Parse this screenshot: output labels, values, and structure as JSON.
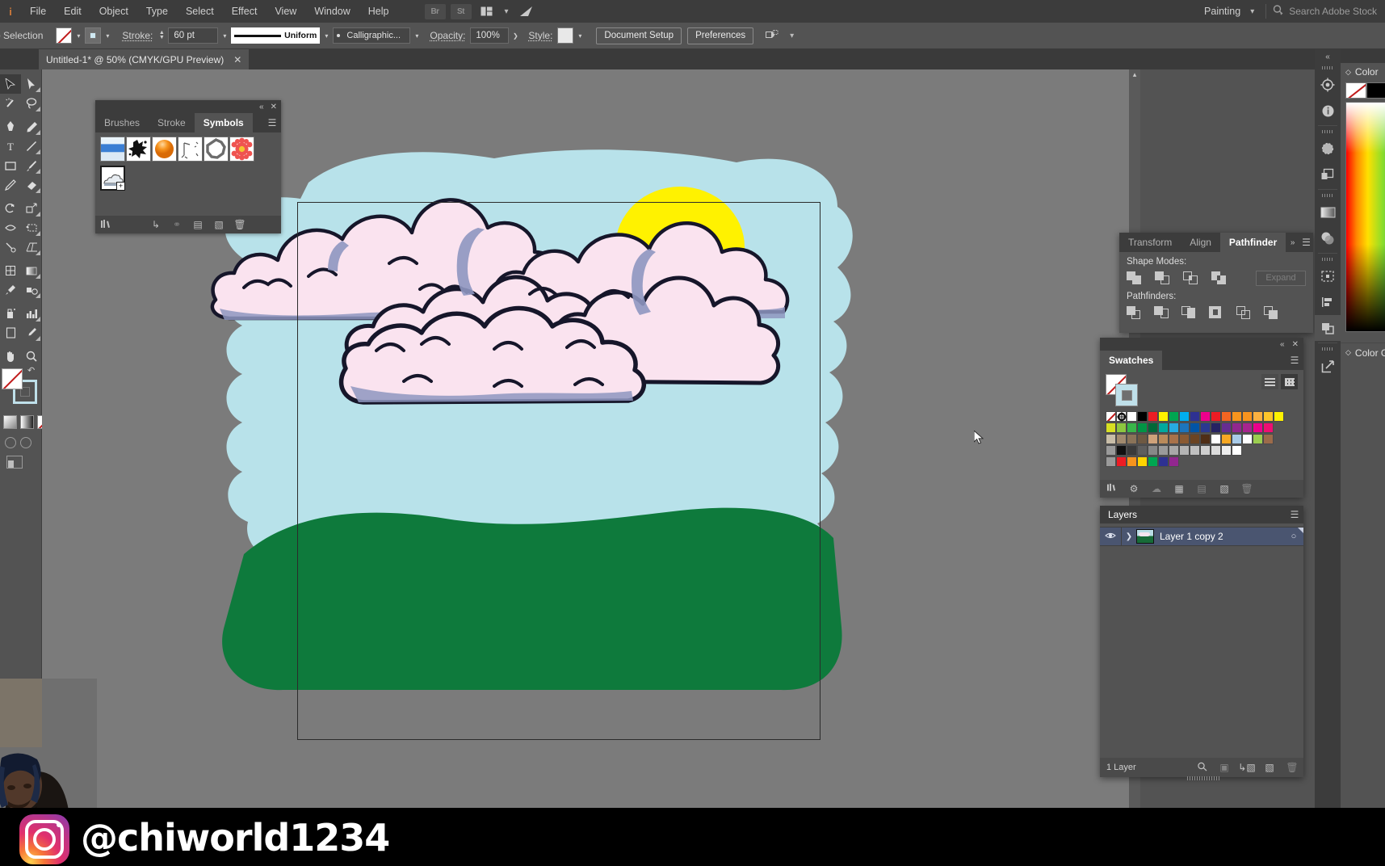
{
  "app": {
    "menus": [
      "File",
      "Edit",
      "Object",
      "Type",
      "Select",
      "Effect",
      "View",
      "Window",
      "Help"
    ],
    "bridge_label": "Br",
    "stock_label": "St",
    "arrange_icon": "arrange-documents-icon",
    "logo_icon": "illustrator-logo-icon",
    "workspace": "Painting",
    "search_placeholder": "Search Adobe Stock",
    "search_icon": "search-icon"
  },
  "controlbar": {
    "selection_status": "o Selection",
    "fill_label": "fill-swatch",
    "stroke_swatch_label": "stroke-swatch",
    "stroke_label": "Stroke:",
    "stroke_weight": "60 pt",
    "profile_name": "Uniform",
    "brush_name": "Calligraphic...",
    "opacity_label": "Opacity:",
    "opacity_value": "100%",
    "style_label": "Style:",
    "document_setup": "Document Setup",
    "preferences": "Preferences",
    "select_similar_icon": "select-similar-objects-icon"
  },
  "document": {
    "tab_title": "Untitled-1* @ 50% (CMYK/GPU Preview)",
    "close_icon": "close-icon",
    "zoom": "50%",
    "color_mode": "CMYK/GPU Preview"
  },
  "toolbar": {
    "tools": [
      "selection-tool",
      "direct-selection-tool",
      "magic-wand-tool",
      "lasso-tool",
      "pen-tool",
      "curvature-tool",
      "type-tool",
      "line-segment-tool",
      "rectangle-tool",
      "paintbrush-tool",
      "shaper-tool",
      "eraser-tool",
      "rotate-tool",
      "scale-tool",
      "width-tool",
      "free-transform-tool",
      "shape-builder-tool",
      "perspective-grid-tool",
      "mesh-tool",
      "gradient-tool",
      "eyedropper-tool",
      "blend-tool",
      "symbol-sprayer-tool",
      "column-graph-tool",
      "artboard-tool",
      "slice-tool",
      "hand-tool",
      "zoom-tool"
    ],
    "fill_state": "none",
    "stroke_state": "selected",
    "fill_stroke_swap_icon": "swap-fill-stroke-icon",
    "color_modes": [
      "color-swatch",
      "gradient-swatch",
      "none-swatch"
    ],
    "draw_modes": [
      "draw-normal",
      "draw-behind",
      "draw-inside"
    ],
    "screen_mode_icon": "change-screen-mode-icon"
  },
  "symbols_panel": {
    "tabs": [
      "Brushes",
      "Stroke",
      "Symbols"
    ],
    "active_tab": "Symbols",
    "collapse_icon": "collapse-panel-icon",
    "close_icon": "close-icon",
    "menu_icon": "panel-menu-icon",
    "symbols": [
      {
        "name": "sky-gradient-symbol",
        "type": "gradient-blue"
      },
      {
        "name": "ink-splat-symbol",
        "type": "splat-black"
      },
      {
        "name": "orange-sphere-symbol",
        "type": "sphere-orange"
      },
      {
        "name": "grass-blades-symbol",
        "type": "sketch-lines"
      },
      {
        "name": "gear-ring-symbol",
        "type": "ring-gray"
      },
      {
        "name": "flower-symbol",
        "type": "flower-red"
      },
      {
        "name": "cloud-symbol",
        "type": "cloud-sketch",
        "selected": true
      }
    ],
    "footer_icons": [
      "symbol-libraries-icon",
      "place-symbol-instance-icon",
      "break-link-icon",
      "symbol-options-icon",
      "new-symbol-icon",
      "delete-symbol-icon"
    ]
  },
  "pathfinder_panel": {
    "tabs": [
      "Transform",
      "Align",
      "Pathfinder"
    ],
    "active_tab": "Pathfinder",
    "expand_tabs_icon": "expand-tabs-icon",
    "menu_icon": "panel-menu-icon",
    "shape_modes_label": "Shape Modes:",
    "shape_modes": [
      "unite-icon",
      "minus-front-icon",
      "intersect-icon",
      "exclude-icon"
    ],
    "expand_button": "Expand",
    "pathfinders_label": "Pathfinders:",
    "pathfinders": [
      "divide-icon",
      "trim-icon",
      "merge-icon",
      "crop-icon",
      "outline-icon",
      "minus-back-icon"
    ]
  },
  "swatches_panel": {
    "title": "Swatches",
    "collapse_icon": "collapse-panel-icon",
    "close_icon": "close-icon",
    "menu_icon": "panel-menu-icon",
    "view_list_icon": "list-view-icon",
    "view_grid_icon": "grid-view-icon",
    "none_swatch": "none-swatch",
    "active_swatch": "active-fill-swatch",
    "rows": [
      [
        "none",
        "registration",
        "#ffffff",
        "#000000",
        "#ec1c24",
        "#fff200",
        "#00a651",
        "#00aeef",
        "#2e3192",
        "#ec008c",
        "#ed1c24",
        "#f26522",
        "#f7941d",
        "#f7931e",
        "#fbb040",
        "#fdc52a",
        "#fff200"
      ],
      [
        "#d7df23",
        "#8dc63f",
        "#39b54a",
        "#009444",
        "#006838",
        "#00a99d",
        "#27aae1",
        "#1c75bc",
        "#0054a6",
        "#2b3990",
        "#262262",
        "#662d91",
        "#92278f",
        "#a7248e",
        "#ec008c",
        "#ed0e72"
      ],
      [
        "#c8bda8",
        "#a18a6e",
        "#8a7358",
        "#6e5942",
        "#cfa27a",
        "#b98a5a",
        "#a8724a",
        "#8a5a32",
        "#6b4423",
        "#4f2e16",
        "#ffffff",
        "#f7a823",
        "#a9cbe8",
        "#ffffff",
        "#9bcd50",
        "#9c6b4a"
      ],
      [
        "folder",
        "#111111",
        "#3a3a3a",
        "#5e5e5e",
        "#888888",
        "#9a9a9a",
        "#a8a8a8",
        "#b4b4b4",
        "#c0c0c0",
        "#cfcfcf",
        "#dcdcdc",
        "#eeeeee",
        "#ffffff"
      ],
      [
        "folder",
        "#ed1c24",
        "#f7941d",
        "#ffd400",
        "#00a651",
        "#2e3192",
        "#92278f"
      ]
    ],
    "footer_icons": [
      "swatch-libraries-icon",
      "show-swatch-kinds-icon",
      "swatch-options-icon",
      "new-color-group-icon",
      "new-swatch-icon",
      "delete-swatch-icon"
    ]
  },
  "layers_panel": {
    "title": "Layers",
    "menu_icon": "panel-menu-icon",
    "layers": [
      {
        "name": "Layer 1 copy 2",
        "visible": true,
        "locked": false,
        "expanded": false,
        "selected": true,
        "eye_icon": "eye-icon",
        "expand_icon": "chevron-right-icon",
        "target_icon": "target-circle-icon"
      }
    ],
    "count_label": "1 Layer",
    "footer_icons": [
      "locate-object-icon",
      "make-clipping-mask-icon",
      "create-new-sublayer-icon",
      "create-new-layer-icon",
      "delete-selection-icon"
    ]
  },
  "color_panel": {
    "title": "Color",
    "guide_title": "Color Gui",
    "none_chip": "none-swatch",
    "fill_chip": "#000000",
    "stroke_chip": "#ffffff",
    "spectrum_label": "color-spectrum-ramp"
  },
  "right_rail": {
    "collapse_icon": "collapse-panels-icon",
    "icons": [
      "color-wheel-icon",
      "info-icon",
      "color-guide-icon",
      "appearance-icon",
      "gradient-icon",
      "transparency-icon",
      "artboards-icon",
      "align-icon",
      "pathfinder-icon",
      "export-icon"
    ]
  },
  "artwork": {
    "description": "Illustration of pink clouds over a light blue sky with a yellow sun and green hills",
    "sky_color": "#b8e2ea",
    "ground_color": "#0e7a3c",
    "sun_color": "#fff200",
    "cloud_fill": "#fae3ef",
    "cloud_shadow": "#8e96c0",
    "cloud_outline": "#1a1a2e",
    "artboard_border": "#2b2b2b"
  },
  "overlay": {
    "instagram_icon": "instagram-logo-icon",
    "handle": "@chiworld1234",
    "webcam_label": "webcam-feed"
  },
  "scrollbars": {
    "h_left_icon": "scroll-left-icon",
    "h_right_icon": "scroll-right-icon",
    "v_up_icon": "scroll-up-icon",
    "v_down_icon": "scroll-down-icon"
  }
}
